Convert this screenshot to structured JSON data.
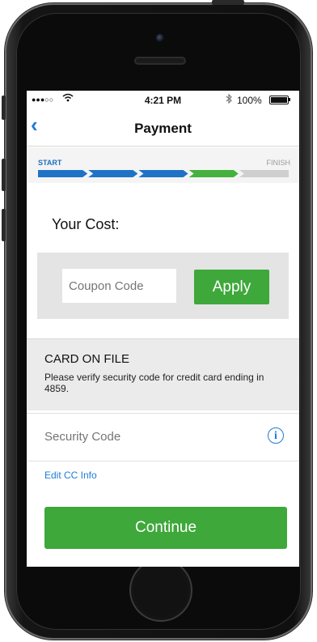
{
  "status_bar": {
    "signal": "●●●○○",
    "time": "4:21 PM",
    "battery": "100%"
  },
  "nav": {
    "back_glyph": "‹",
    "title": "Payment"
  },
  "progress": {
    "start_label": "START",
    "finish_label": "FINISH",
    "segments_total": 5,
    "segments_completed": 3,
    "current_segment": 4,
    "colors": {
      "completed": "#1f73c6",
      "current": "#45b13f",
      "remaining": "#cfcfcf"
    }
  },
  "cost": {
    "label": "Your Cost:"
  },
  "coupon": {
    "placeholder": "Coupon Code",
    "apply_label": "Apply"
  },
  "card": {
    "title": "CARD ON FILE",
    "description": "Please verify security code for credit card ending in 4859."
  },
  "security": {
    "placeholder": "Security Code",
    "info_glyph": "i",
    "info_icon": "info-icon"
  },
  "edit_link": "Edit CC Info",
  "continue_label": "Continue",
  "colors": {
    "primary_blue": "#1e7bd6",
    "action_green": "#3ea83a"
  }
}
